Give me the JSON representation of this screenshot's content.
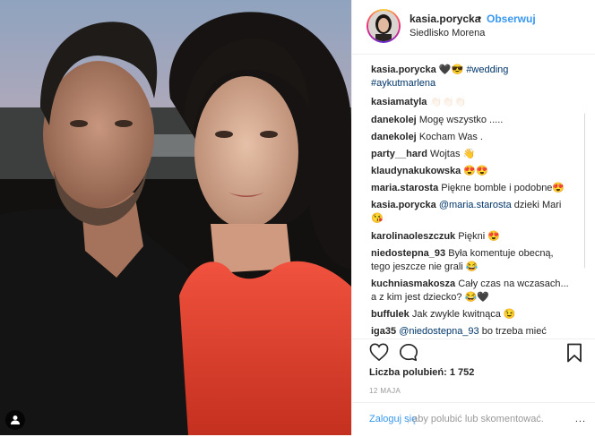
{
  "post": {
    "username": "kasia.porycka",
    "separator": "•",
    "follow_label": "Obserwuj",
    "location": "Siedlisko Morena"
  },
  "caption": {
    "username": "kasia.porycka",
    "text": "🖤😎",
    "tags": [
      "#wedding",
      "#aykutmarlena"
    ]
  },
  "comments": [
    {
      "user": "kasiamatyla",
      "text": "👏🏻👏🏻👏🏻"
    },
    {
      "user": "danekolej",
      "text": "Mogę wszystko ....."
    },
    {
      "user": "danekolej",
      "text": "Kocham Was ."
    },
    {
      "user": "party__hard",
      "text": "Wojtas 👋"
    },
    {
      "user": "klaudynakukowska",
      "text": "😍😍"
    },
    {
      "user": "maria.starosta",
      "text": "Piękne bomble i podobne😍"
    },
    {
      "user": "kasia.porycka",
      "mention": "@maria.starosta",
      "text": " dzieki Mari",
      "line2": "😘"
    },
    {
      "user": "karolinaoleszczuk",
      "text": "Piękni 😍"
    },
    {
      "user": "niedostepna_93",
      "text": "Była komentuje obecną,",
      "line2": "tego jeszcze nie grali 😂"
    },
    {
      "user": "kuchniasmakosza",
      "text": "Cały czas na wczasach...",
      "line2": "a z kim jest dziecko? 😂🖤"
    },
    {
      "user": "buffulek",
      "text": "Jak zwykle kwitnąca 😉"
    },
    {
      "user": "iga35",
      "mention": "@niedostepna_93",
      "text": " bo trzeba mieć"
    }
  ],
  "likes": "Liczba polubień: 1 752",
  "date": "12 MAJA",
  "login": {
    "link": "Zaloguj się",
    "rest": ", aby polubić lub skomentować.",
    "more": "..."
  },
  "icons": {
    "heart": "heart-icon",
    "comment": "comment-icon",
    "bookmark": "bookmark-icon",
    "user_tag": "person-icon"
  }
}
